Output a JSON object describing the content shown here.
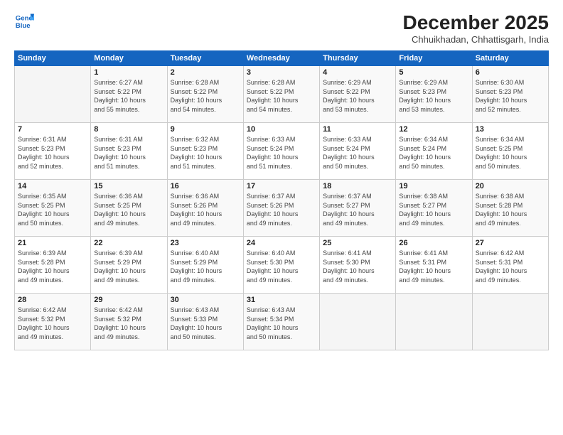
{
  "header": {
    "logo_line1": "General",
    "logo_line2": "Blue",
    "month": "December 2025",
    "location": "Chhuikhadan, Chhattisgarh, India"
  },
  "columns": [
    "Sunday",
    "Monday",
    "Tuesday",
    "Wednesday",
    "Thursday",
    "Friday",
    "Saturday"
  ],
  "weeks": [
    [
      {
        "day": "",
        "text": ""
      },
      {
        "day": "1",
        "text": "Sunrise: 6:27 AM\nSunset: 5:22 PM\nDaylight: 10 hours\nand 55 minutes."
      },
      {
        "day": "2",
        "text": "Sunrise: 6:28 AM\nSunset: 5:22 PM\nDaylight: 10 hours\nand 54 minutes."
      },
      {
        "day": "3",
        "text": "Sunrise: 6:28 AM\nSunset: 5:22 PM\nDaylight: 10 hours\nand 54 minutes."
      },
      {
        "day": "4",
        "text": "Sunrise: 6:29 AM\nSunset: 5:22 PM\nDaylight: 10 hours\nand 53 minutes."
      },
      {
        "day": "5",
        "text": "Sunrise: 6:29 AM\nSunset: 5:23 PM\nDaylight: 10 hours\nand 53 minutes."
      },
      {
        "day": "6",
        "text": "Sunrise: 6:30 AM\nSunset: 5:23 PM\nDaylight: 10 hours\nand 52 minutes."
      }
    ],
    [
      {
        "day": "7",
        "text": "Sunrise: 6:31 AM\nSunset: 5:23 PM\nDaylight: 10 hours\nand 52 minutes."
      },
      {
        "day": "8",
        "text": "Sunrise: 6:31 AM\nSunset: 5:23 PM\nDaylight: 10 hours\nand 51 minutes."
      },
      {
        "day": "9",
        "text": "Sunrise: 6:32 AM\nSunset: 5:23 PM\nDaylight: 10 hours\nand 51 minutes."
      },
      {
        "day": "10",
        "text": "Sunrise: 6:33 AM\nSunset: 5:24 PM\nDaylight: 10 hours\nand 51 minutes."
      },
      {
        "day": "11",
        "text": "Sunrise: 6:33 AM\nSunset: 5:24 PM\nDaylight: 10 hours\nand 50 minutes."
      },
      {
        "day": "12",
        "text": "Sunrise: 6:34 AM\nSunset: 5:24 PM\nDaylight: 10 hours\nand 50 minutes."
      },
      {
        "day": "13",
        "text": "Sunrise: 6:34 AM\nSunset: 5:25 PM\nDaylight: 10 hours\nand 50 minutes."
      }
    ],
    [
      {
        "day": "14",
        "text": "Sunrise: 6:35 AM\nSunset: 5:25 PM\nDaylight: 10 hours\nand 50 minutes."
      },
      {
        "day": "15",
        "text": "Sunrise: 6:36 AM\nSunset: 5:25 PM\nDaylight: 10 hours\nand 49 minutes."
      },
      {
        "day": "16",
        "text": "Sunrise: 6:36 AM\nSunset: 5:26 PM\nDaylight: 10 hours\nand 49 minutes."
      },
      {
        "day": "17",
        "text": "Sunrise: 6:37 AM\nSunset: 5:26 PM\nDaylight: 10 hours\nand 49 minutes."
      },
      {
        "day": "18",
        "text": "Sunrise: 6:37 AM\nSunset: 5:27 PM\nDaylight: 10 hours\nand 49 minutes."
      },
      {
        "day": "19",
        "text": "Sunrise: 6:38 AM\nSunset: 5:27 PM\nDaylight: 10 hours\nand 49 minutes."
      },
      {
        "day": "20",
        "text": "Sunrise: 6:38 AM\nSunset: 5:28 PM\nDaylight: 10 hours\nand 49 minutes."
      }
    ],
    [
      {
        "day": "21",
        "text": "Sunrise: 6:39 AM\nSunset: 5:28 PM\nDaylight: 10 hours\nand 49 minutes."
      },
      {
        "day": "22",
        "text": "Sunrise: 6:39 AM\nSunset: 5:29 PM\nDaylight: 10 hours\nand 49 minutes."
      },
      {
        "day": "23",
        "text": "Sunrise: 6:40 AM\nSunset: 5:29 PM\nDaylight: 10 hours\nand 49 minutes."
      },
      {
        "day": "24",
        "text": "Sunrise: 6:40 AM\nSunset: 5:30 PM\nDaylight: 10 hours\nand 49 minutes."
      },
      {
        "day": "25",
        "text": "Sunrise: 6:41 AM\nSunset: 5:30 PM\nDaylight: 10 hours\nand 49 minutes."
      },
      {
        "day": "26",
        "text": "Sunrise: 6:41 AM\nSunset: 5:31 PM\nDaylight: 10 hours\nand 49 minutes."
      },
      {
        "day": "27",
        "text": "Sunrise: 6:42 AM\nSunset: 5:31 PM\nDaylight: 10 hours\nand 49 minutes."
      }
    ],
    [
      {
        "day": "28",
        "text": "Sunrise: 6:42 AM\nSunset: 5:32 PM\nDaylight: 10 hours\nand 49 minutes."
      },
      {
        "day": "29",
        "text": "Sunrise: 6:42 AM\nSunset: 5:32 PM\nDaylight: 10 hours\nand 49 minutes."
      },
      {
        "day": "30",
        "text": "Sunrise: 6:43 AM\nSunset: 5:33 PM\nDaylight: 10 hours\nand 50 minutes."
      },
      {
        "day": "31",
        "text": "Sunrise: 6:43 AM\nSunset: 5:34 PM\nDaylight: 10 hours\nand 50 minutes."
      },
      {
        "day": "",
        "text": ""
      },
      {
        "day": "",
        "text": ""
      },
      {
        "day": "",
        "text": ""
      }
    ]
  ]
}
